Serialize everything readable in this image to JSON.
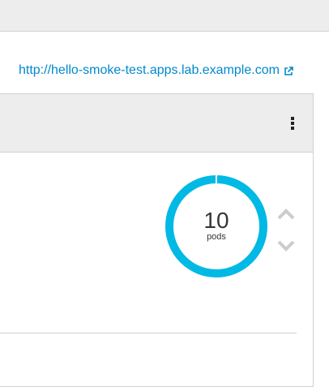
{
  "route": {
    "url": "http://hello-smoke-test.apps.lab.example.com",
    "icon": "external-link-icon"
  },
  "deployment": {
    "menu_icon": "kebab-menu-icon",
    "pods": {
      "count": "10",
      "unit": "pods",
      "ring_color": "#00b9e4",
      "gap_color": "#ffffff"
    },
    "scale_up_icon": "chevron-up-icon",
    "scale_down_icon": "chevron-down-icon",
    "control_color": "#cccccc"
  }
}
